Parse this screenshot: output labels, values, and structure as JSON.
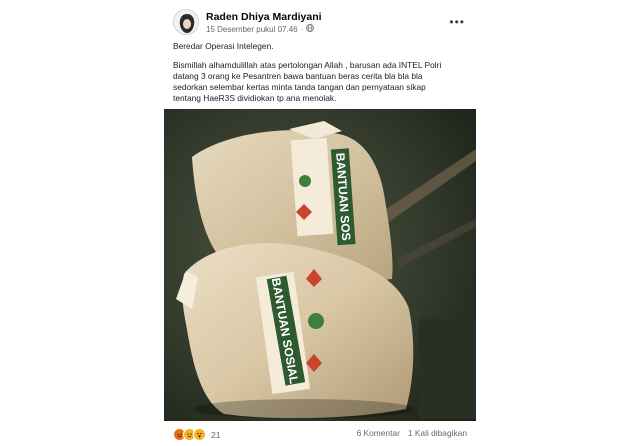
{
  "post": {
    "author": "Raden Dhiya Mardiyani",
    "date": "15 Desember pukul 07.46",
    "privacy_separator": "·",
    "more_label": "•••",
    "title_line": "Beredar Operasi Intelegen.",
    "message": "Bismillah alhamdulillah atas pertolongan Allah , barusan ada INTEL Polri\ndatang 3 orang ke Pesantren bawa bantuan beras cerita bla bla bla\nsedorkan selembar kertas minta tanda tangan dan pernyataan sikap\ntentang HaeR3S dividiokan tp ana menolak.",
    "photo": {
      "bag_label": "BANTUAN SOSIAL",
      "bag_label_top": "BANTUAN SOS"
    },
    "reaction_icons": [
      "angry-reaction-icon",
      "sad-reaction-icon",
      "wow-reaction-icon"
    ],
    "reaction_count": "21",
    "comments": "6 Komentar",
    "shares": "1 Kali dibagikan"
  },
  "colors": {
    "angry": "#e9710f",
    "sad": "#f7b125",
    "wow": "#f7b125",
    "bag": "#d8c8a8",
    "label_green": "#2e5a2f"
  }
}
